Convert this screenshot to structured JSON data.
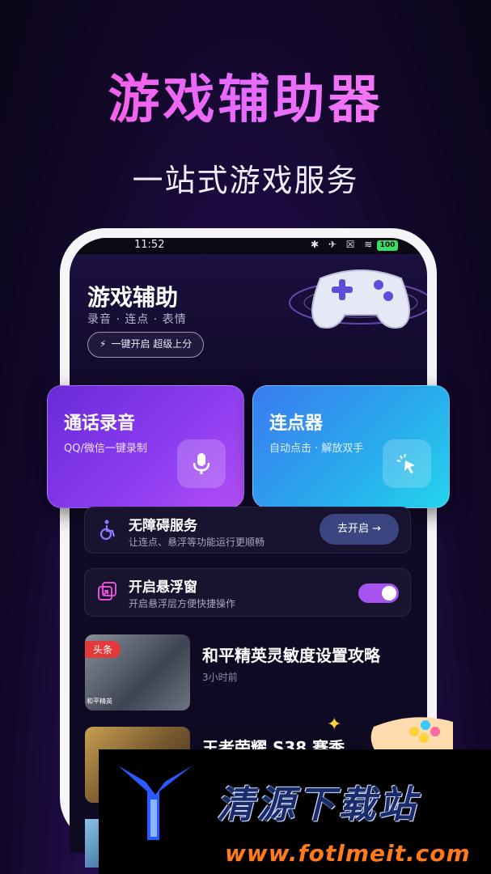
{
  "hero": {
    "title": "游戏辅助器",
    "subtitle": "一站式游戏服务"
  },
  "statusbar": {
    "time": "11:52",
    "battery": "100"
  },
  "app": {
    "title": "游戏辅助",
    "subtitle": "录音 · 连点 · 表情",
    "quick_button": "一键开启 超级上分"
  },
  "cards": {
    "record": {
      "title": "通话录音",
      "subtitle": "QQ/微信一键录制",
      "icon": "microphone-icon"
    },
    "clicker": {
      "title": "连点器",
      "subtitle": "自动点击 · 解放双手",
      "icon": "tap-cursor-icon"
    }
  },
  "accessibility": {
    "title": "无障碍服务",
    "subtitle": "让连点、悬浮等功能运行更顺畅",
    "button": "去开启 →",
    "icon": "wheelchair-icon"
  },
  "floating": {
    "title": "开启悬浮窗",
    "subtitle": "开启悬浮层方便快捷操作",
    "enabled": true,
    "icon": "floating-window-icon"
  },
  "news": [
    {
      "tag": "头条",
      "title": "和平精英灵敏度设置攻略",
      "time": "3小时前",
      "thumb_caption": "和平精英"
    },
    {
      "title": "王者荣耀 S38 赛季"
    }
  ],
  "watermark": {
    "name": "清源下载站",
    "url": "www.fotlmeit.com"
  },
  "colors": {
    "accent_pink": "#ff5ad8",
    "record_card": "#8a3cf0",
    "clicker_card": "#2aa8ec",
    "toggle_on": "#a654f0",
    "news_tag": "#e23a3a"
  }
}
